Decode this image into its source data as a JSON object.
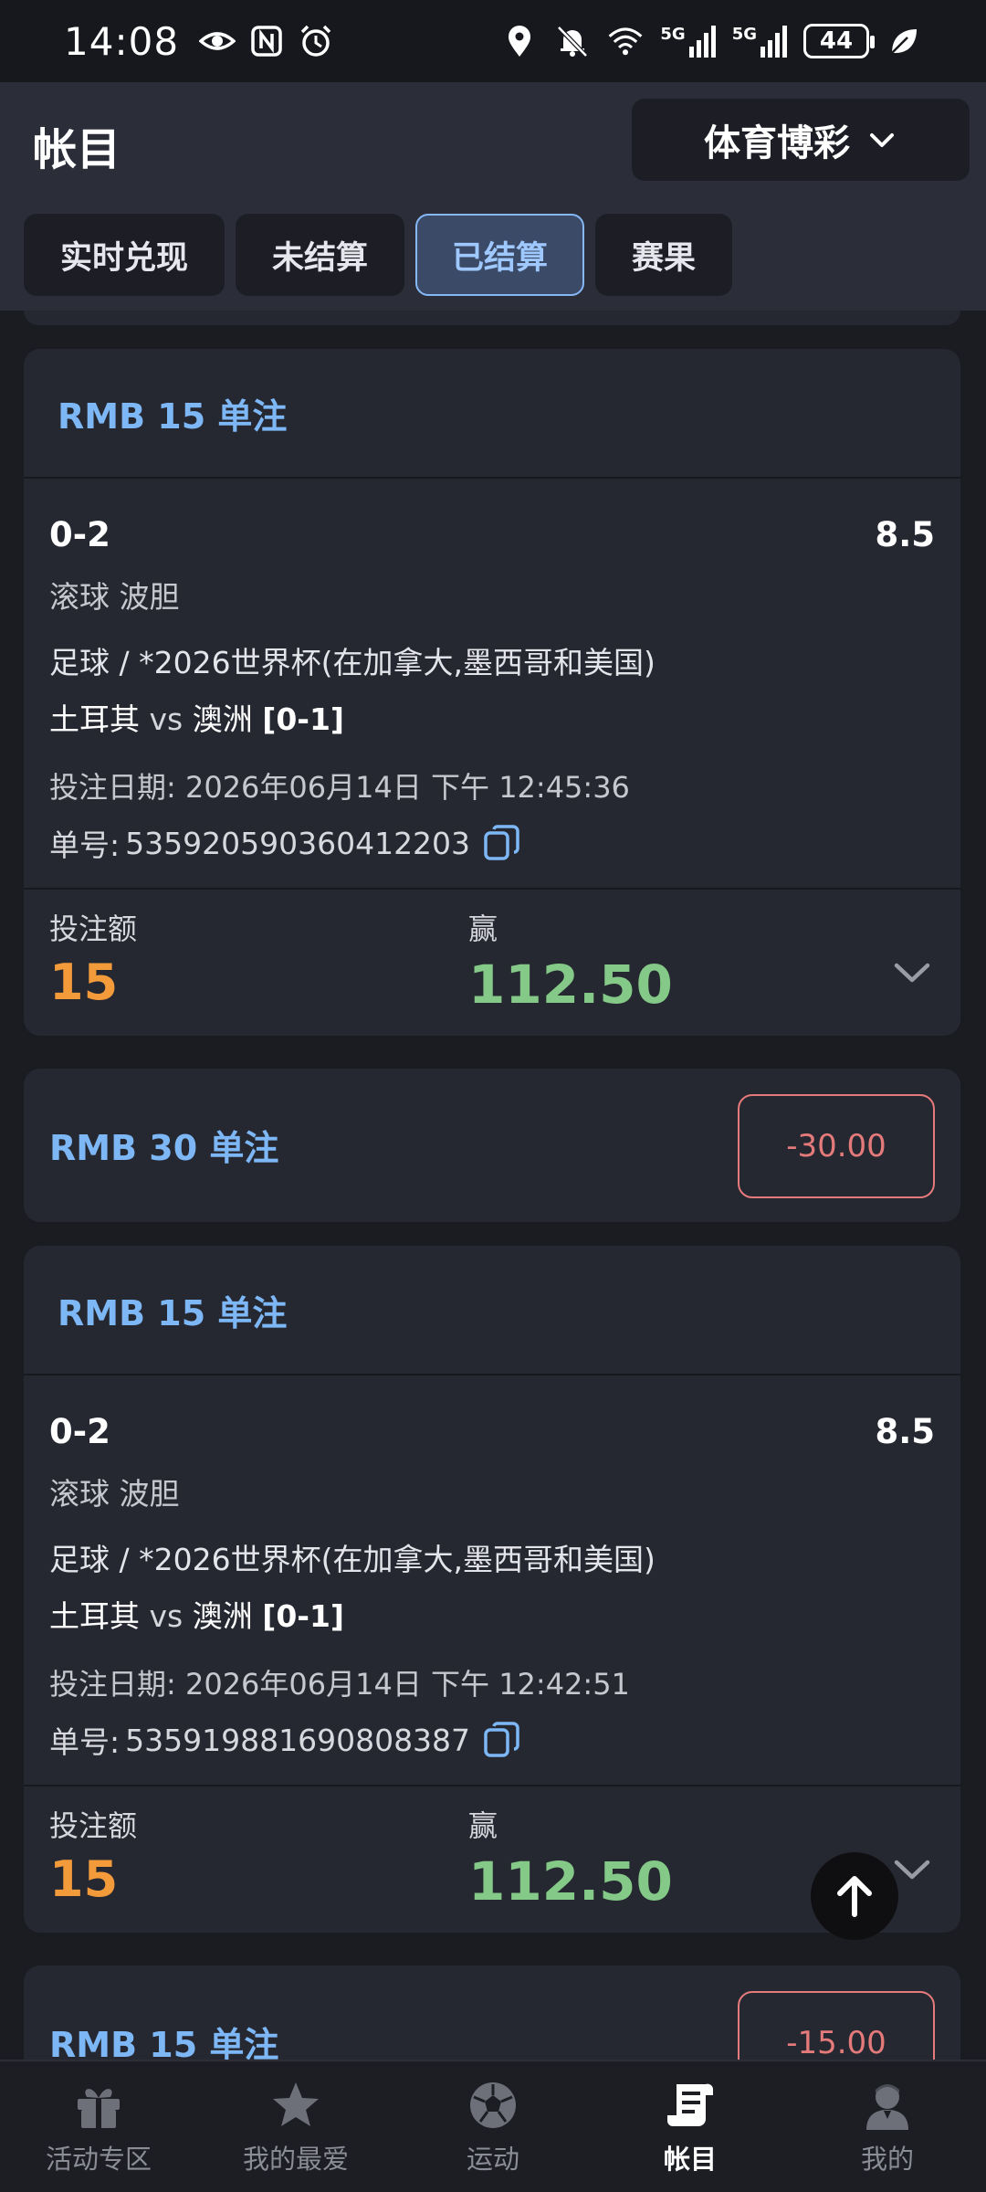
{
  "status_bar": {
    "time": "14:08",
    "battery": "44",
    "net_1": "5G",
    "net_2": "5G"
  },
  "header": {
    "title": "帐目",
    "product_select": "体育博彩"
  },
  "tabs": [
    {
      "label": "实时兑现",
      "active": false
    },
    {
      "label": "未结算",
      "active": false
    },
    {
      "label": "已结算",
      "active": true
    },
    {
      "label": "赛果",
      "active": false
    }
  ],
  "bets": [
    {
      "header": "RMB 15 单注",
      "selection": "0-2",
      "odds": "8.5",
      "market": "滚球 波胆",
      "league": "足球 / *2026世界杯(在加拿大,墨西哥和美国)",
      "home": "土耳其",
      "vs": "vs",
      "away": "澳洲",
      "score": "[0-1]",
      "date_label": "投注日期:",
      "date": "2026年06月14日 下午 12:45:36",
      "order_label": "单号:",
      "order_no": "535920590360412203",
      "stake_label": "投注额",
      "stake": "15",
      "win_label": "赢",
      "win": "112.50"
    },
    {
      "header": "RMB 15 单注",
      "selection": "0-2",
      "odds": "8.5",
      "market": "滚球 波胆",
      "league": "足球 / *2026世界杯(在加拿大,墨西哥和美国)",
      "home": "土耳其",
      "vs": "vs",
      "away": "澳洲",
      "score": "[0-1]",
      "date_label": "投注日期:",
      "date": "2026年06月14日 下午 12:42:51",
      "order_label": "单号:",
      "order_no": "535919881690808387",
      "stake_label": "投注额",
      "stake": "15",
      "win_label": "赢",
      "win": "112.50"
    }
  ],
  "collapsed_bets": [
    {
      "header": "RMB 30 单注",
      "result": "-30.00"
    },
    {
      "header": "RMB 15 单注",
      "result": "-15.00"
    }
  ],
  "bottom_nav": [
    {
      "label": "活动专区",
      "icon": "gift-icon",
      "active": false
    },
    {
      "label": "我的最爱",
      "icon": "star-icon",
      "active": false
    },
    {
      "label": "运动",
      "icon": "soccer-ball-icon",
      "active": false
    },
    {
      "label": "帐目",
      "icon": "receipt-icon",
      "active": true
    },
    {
      "label": "我的",
      "icon": "profile-icon",
      "active": false
    }
  ],
  "colors": {
    "accent_blue": "#7db7f6",
    "stake_orange": "#f39a3b",
    "win_green": "#84c987",
    "loss_red": "#e57a7a",
    "card_bg": "#262831"
  }
}
